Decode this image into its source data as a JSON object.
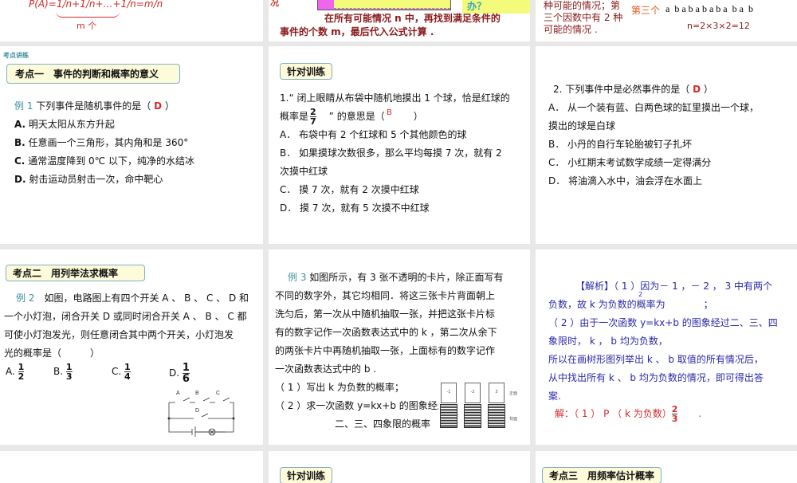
{
  "row0": {
    "s1": {
      "formula": "P(A)=1/n+1/n+…+1/n=m/n",
      "under": "m 个"
    },
    "s2": {
      "left_char": "况",
      "line1": "在所有可能情况 n 中，再找到满足条件的",
      "line2": "事件的个数 m，最后代入公式计算 .",
      "note": "办？"
    },
    "s3": {
      "lines": [
        "种可能的情况；第",
        "三个因数中有 2 种",
        "可能的情况 ."
      ],
      "label": "第三个",
      "letters": "a  b a b a b a b a  b a  b",
      "n": "n=2×3×2=12"
    }
  },
  "slide1": {
    "section": "考点讲练",
    "heading": "考点一　事件的判断和概率的意义",
    "ex_label": "例 1",
    "question": "下列事件是随机事件的是（",
    "answer": "D",
    "close": "）",
    "options": [
      {
        "k": "A.",
        "t": "明天太阳从东方升起"
      },
      {
        "k": "B.",
        "t": "任意画一个三角形，其内角和是 360°"
      },
      {
        "k": "C.",
        "t": "通常温度降到 0℃ 以下，纯净的水结冰"
      },
      {
        "k": "D.",
        "t": "射击运动员射击一次，命中靶心"
      }
    ]
  },
  "slide2": {
    "heading": "针对训练",
    "q1": "1.“ 闭上眼睛从布袋中随机地摸出 1 个球，恰是红球的",
    "q2a": "概率是",
    "frac_n": "2",
    "frac_d": "7",
    "q2b": "” 的意思是（　　　）",
    "mark": "B",
    "options": [
      "A． 布袋中有 2 个红球和 5 个其他颜色的球",
      "B． 如果摸球次数很多，那么平均每摸 7 次，就有 2",
      "次摸中红球",
      "C． 摸 7 次，就有 2 次摸中红球",
      "D． 摸 7 次，就有 5 次摸不中红球"
    ]
  },
  "slide3": {
    "question": "2. 下列事件中是必然事件的是（",
    "answer": "D",
    "close": "）",
    "options": [
      "A． 从一个装有蓝、白两色球的缸里摸出一个球，",
      "摸出的球是白球",
      "B． 小丹的自行车轮胎被钉子扎坏",
      "C． 小红期末考试数学成绩一定得满分",
      "D． 将油滴入水中，油会浮在水面上"
    ]
  },
  "slide4": {
    "heading": "考点二　用列举法求概率",
    "ex_label": "例 2",
    "lines": [
      "如图，电路图上有四个开关 A 、 B 、 C 、 D 和",
      "一个小灯泡，闭合开关 D 或同时闭合开关 A 、 B 、 C 都",
      "可使小灯泡发光，则任意闭合其中两个开关，小灯泡发",
      "光的概率是（　　　）"
    ],
    "choices": [
      {
        "k": "A.",
        "n": "1",
        "d": "2"
      },
      {
        "k": "B.",
        "n": "1",
        "d": "3"
      },
      {
        "k": "C.",
        "n": "1",
        "d": "4"
      },
      {
        "k": "D.",
        "n": "1",
        "d": "6"
      }
    ],
    "switches": [
      "A",
      "B",
      "C",
      "D"
    ]
  },
  "slide5": {
    "ex_label": "例 3",
    "lines": [
      "如图所示，有 3 张不透明的卡片，除正面写有",
      "不同的数字外，其它均相同．将这三张卡片背面朝上",
      "洗匀后，第一次从中随机抽取一张，并把这张卡片标",
      "有的数字记作一次函数表达式中的 k ，第二次从余下",
      "的两张卡片中再随机抽取一张，上面标有的数字记作",
      "一次函数表达式中的 b ."
    ],
    "p1": "（ 1 ）写出 k 为负数的概率；",
    "p2": "（ 2 ）求一次函数 y=kx+b 的图象经过",
    "p3": "二、三、四象限的概率",
    "cards": [
      "-1",
      "-2",
      "3"
    ],
    "front": "正面",
    "back": "背面"
  },
  "slide6": {
    "lines": [
      "【解析】（ 1 ）因为－ 1 ，－ 2 ， 3 中有两个",
      "负数，故 k 为负数的概率为　　　　；",
      "（ 2 ）由于一次函数 y=kx+b 的图象经过二、三、四",
      "象限时， k ， b 均为负数，",
      "所以在画树形图列举出 k 、 b 取值的所有情况后，",
      "从中找出所有 k 、 b 均为负数的情况，即可得出答",
      "案."
    ],
    "frac_top": "2",
    "solution": "解：（ 1 ） P （ k 为负数）",
    "sol_n": "2",
    "sol_d": "3",
    "sol_end": "."
  },
  "row3": {
    "s2": "针对训练",
    "s3": "考点三　用频率估计概率"
  }
}
